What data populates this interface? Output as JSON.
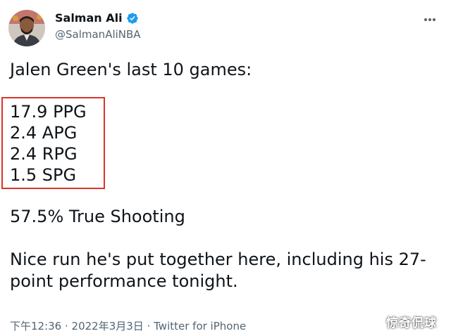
{
  "author": {
    "name": "Salman Ali",
    "handle": "@SalmanAliNBA",
    "verified": true
  },
  "tweet": {
    "intro": "Jalen Green's last 10 games:",
    "stats": [
      "17.9 PPG",
      "2.4 APG",
      "2.4 RPG",
      "1.5 SPG"
    ],
    "true_shooting": "57.5% True Shooting",
    "comment": "Nice run he's put together here, including his 27-point performance tonight."
  },
  "meta": {
    "time": "下午12:36",
    "separator1": " · ",
    "date": "2022年3月3日",
    "separator2": " · ",
    "source": "Twitter for iPhone"
  },
  "watermark": "惊奇侃球",
  "colors": {
    "highlight_border": "#d9342b",
    "verified_blue": "#1d9bf0",
    "text_primary": "#0f1419",
    "text_secondary": "#536471"
  },
  "icons": {
    "verified": "verified-badge-icon",
    "more": "more-dots-icon"
  }
}
